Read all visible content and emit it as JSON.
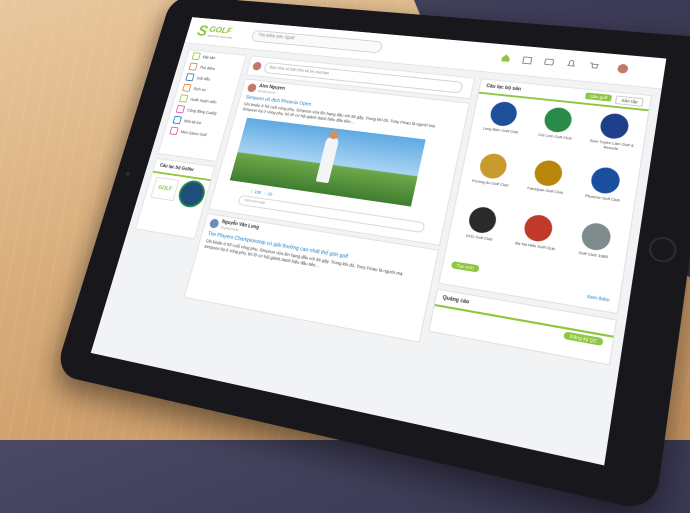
{
  "app": {
    "logo_text": "GOLF",
    "logo_tagline": "Social Golf Community",
    "search_placeholder": "Tìm kiếm trên Sgolf"
  },
  "sidebar": {
    "items": [
      {
        "label": "Đặt sân",
        "icon": "flag-icon",
        "color": "#8dc63f"
      },
      {
        "label": "Thẻ điểm",
        "icon": "scorecard-icon",
        "color": "#e57c2f"
      },
      {
        "label": "Giải đấu",
        "icon": "trophy-icon",
        "color": "#1a7bbf"
      },
      {
        "label": "Dịch vụ",
        "icon": "service-icon",
        "color": "#e57c2f"
      },
      {
        "label": "Huấn luyện viên",
        "icon": "coach-icon",
        "color": "#8dc63f"
      },
      {
        "label": "Cộng đồng Caddy",
        "icon": "caddy-icon",
        "color": "#d45aa8"
      },
      {
        "label": "Nhà tài trợ",
        "icon": "sponsor-icon",
        "color": "#1a7bbf"
      },
      {
        "label": "Mini Game Golf",
        "icon": "game-icon",
        "color": "#d45aa8"
      }
    ],
    "clubs_title": "Câu lạc bộ Golfer",
    "club_a": "GOLF"
  },
  "composer": {
    "placeholder": "Bạn chia sẻ bài chia sẻ tin của bạn"
  },
  "posts": [
    {
      "author": "Alex Nguyen",
      "time": "25 phút trước",
      "title": "Simpson vô địch Phoenix Open",
      "body": "Ghi birdie ở hố cuối vòng phụ, Simpson vừa lên hạng đầu với 56 gậy. Trong khi đó, Tony Finau là người mà Simpson hạ ở vòng phụ, bỏ lỡ cơ hội giành danh hiệu đầu tiên...",
      "likes": "100",
      "comments": "10",
      "comment_placeholder": "Viết bình luận"
    },
    {
      "author": "Nguyễn Văn Long",
      "time": "15 phút trước",
      "title": "The Players Championship có giải thưởng cao nhất thế giới golf",
      "body": "Ghi birdie ở hố cuối vòng phụ, Simpson vừa lên hạng đầu với 56 gậy. Trong khi đó, Tony Finau là người mà Simpson hạ ở vòng phụ, bỏ lỡ cơ hội giành danh hiệu đầu tiên..."
    }
  ],
  "right_panel": {
    "title": "Câu lạc bộ sân",
    "tab_active": "Sân golf",
    "tab_other": "Sân tập",
    "clubs": [
      {
        "name": "Long Biên Golf Club",
        "color": "#1e4f9a"
      },
      {
        "name": "Chi Linh Golf Club",
        "color": "#2a8a4a"
      },
      {
        "name": "Sam Tuyền Lâm Golf & Resorts",
        "color": "#1e3f8a"
      },
      {
        "name": "Trường An Golf Club",
        "color": "#c99a2e"
      },
      {
        "name": "Fansipan Golf Club",
        "color": "#b8860b"
      },
      {
        "name": "Phoenix Golf Club",
        "color": "#1a4fa0"
      },
      {
        "name": "1011 Golf Club",
        "color": "#2a2a2a"
      },
      {
        "name": "Ba Na Hills Golf Club",
        "color": "#c0392b"
      },
      {
        "name": "Golf Club 1989",
        "color": "#7f8c8d"
      }
    ],
    "create_button": "Tạo mới",
    "more_link": "Xem thêm"
  },
  "ads": {
    "title": "Quảng cáo",
    "register_button": "Đăng ký QC"
  },
  "colors": {
    "accent": "#8dc63f",
    "link": "#1a7bbf"
  }
}
